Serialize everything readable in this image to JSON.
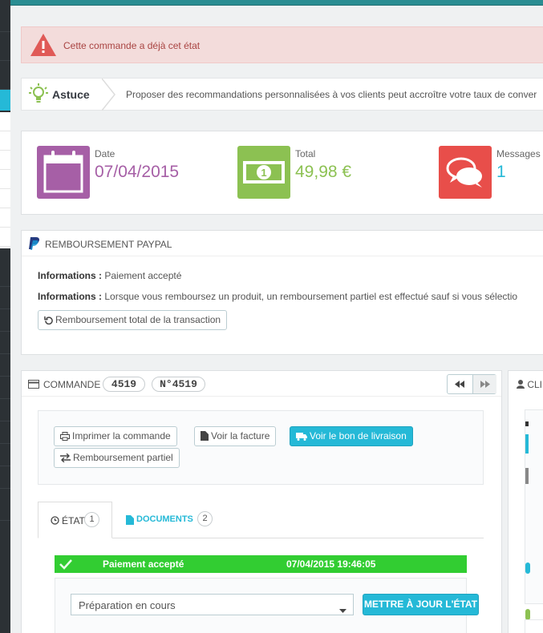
{
  "alert": {
    "message": "Cette commande a déjà cet état",
    "icon": "warning-icon"
  },
  "tip": {
    "label": "Astuce",
    "message": "Proposer des recommandations personnalisées à vos clients peut accroître votre taux de conver",
    "icon": "lightbulb-icon"
  },
  "kpis": [
    {
      "title": "Date",
      "value": "07/04/2015",
      "color": "#a65fa6",
      "icon": "calendar-icon"
    },
    {
      "title": "Total",
      "value": "49,98 €",
      "color": "#8cc152",
      "icon": "banknote-icon"
    },
    {
      "title": "Messages",
      "value": "1",
      "color": "#25b9d7",
      "icon": "chat-bubbles-icon"
    }
  ],
  "paypal": {
    "title": "REMBOURSEMENT PAYPAL",
    "info1_label": "Informations :",
    "info1_value": "Paiement accepté",
    "info2_label": "Informations :",
    "info2_value": "Lorsque vous remboursez un produit, un remboursement partiel est effectué sauf si vous sélectio",
    "refund_button": "Remboursement total de la transaction"
  },
  "order": {
    "title": "COMMANDE",
    "id": "4519",
    "ref": "N°4519",
    "buttons": {
      "print": "Imprimer la commande",
      "invoice": "Voir la facture",
      "delivery": "Voir le bon de livraison",
      "partial_refund": "Remboursement partiel"
    },
    "tabs": [
      {
        "label": "ÉTAT",
        "count": "1"
      },
      {
        "label": "DOCUMENTS",
        "count": "2"
      }
    ],
    "status": {
      "name": "Paiement accepté",
      "date": "07/04/2015 19:46:05",
      "color": "#32cd32"
    },
    "state_select": "Préparation en cours",
    "update_button": "METTRE À JOUR L'ÉTAT"
  },
  "client": {
    "title": "CLIE"
  }
}
